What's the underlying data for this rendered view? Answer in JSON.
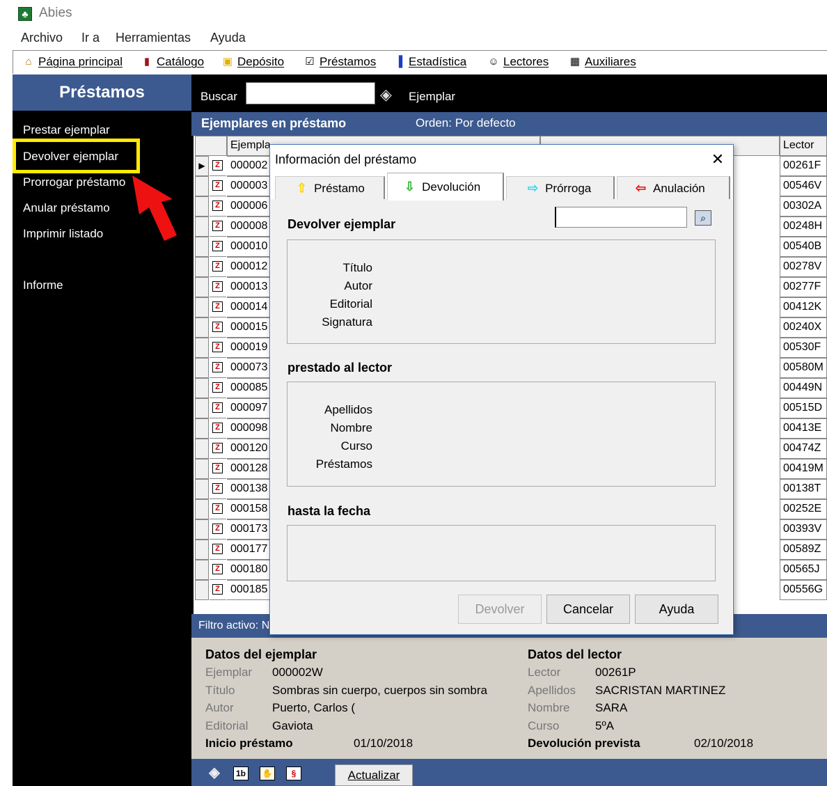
{
  "window": {
    "title": "Abies"
  },
  "menu": [
    "Archivo",
    "Ir a",
    "Herramientas",
    "Ayuda"
  ],
  "toolbar": [
    {
      "icon": "home-icon",
      "label": "Página principal"
    },
    {
      "icon": "books-icon",
      "label": "Catálogo"
    },
    {
      "icon": "jar-icon",
      "label": "Depósito"
    },
    {
      "icon": "checkbox-icon",
      "label": "Préstamos"
    },
    {
      "icon": "bar-chart-icon",
      "label": "Estadística"
    },
    {
      "icon": "readers-icon",
      "label": "Lectores"
    },
    {
      "icon": "table-icon",
      "label": "Auxiliares"
    }
  ],
  "sidebar": {
    "title": "Préstamos",
    "items": [
      "Prestar ejemplar",
      "Devolver ejemplar",
      "Prorrogar préstamo",
      "Anular préstamo",
      "Imprimir listado",
      "Informe"
    ],
    "highlight_color": "#ffeb00"
  },
  "search": {
    "label": "Buscar",
    "value": "",
    "mode": "Ejemplar"
  },
  "list": {
    "title": "Ejemplares en préstamo",
    "order": "Orden: Por defecto",
    "columns": {
      "ejemplar": "Ejempla",
      "lector": "Lector"
    },
    "rows": [
      {
        "code": "000002",
        "lector": "00261F"
      },
      {
        "code": "000003",
        "lector": "00546V"
      },
      {
        "code": "000006",
        "lector": "00302A"
      },
      {
        "code": "000008",
        "lector": "00248H"
      },
      {
        "code": "000010",
        "lector": "00540B"
      },
      {
        "code": "000012",
        "lector": "00278V"
      },
      {
        "code": "000013",
        "lector": "00277F"
      },
      {
        "code": "000014",
        "lector": "00412K"
      },
      {
        "code": "000015",
        "lector": "00240X"
      },
      {
        "code": "000019",
        "lector": "00530F"
      },
      {
        "code": "000073",
        "lector": "00580M"
      },
      {
        "code": "000085",
        "lector": "00449N"
      },
      {
        "code": "000097",
        "lector": "00515D"
      },
      {
        "code": "000098",
        "lector": "00413E"
      },
      {
        "code": "000120",
        "lector": "00474Z"
      },
      {
        "code": "000128",
        "lector": "00419M"
      },
      {
        "code": "000138",
        "lector": "00138T"
      },
      {
        "code": "000158",
        "lector": "00252E"
      },
      {
        "code": "000173",
        "lector": "00393V"
      },
      {
        "code": "000177",
        "lector": "00589Z"
      },
      {
        "code": "000180",
        "lector": "00565J"
      },
      {
        "code": "000185",
        "lector": "00556G"
      }
    ]
  },
  "filter": {
    "label": "Filtro activo: N"
  },
  "details": {
    "ejemplar_title": "Datos del ejemplar",
    "lector_title": "Datos del lector",
    "ejemplar_fields": [
      {
        "key": "Ejemplar",
        "value": "000002W"
      },
      {
        "key": "Título",
        "value": "Sombras sin cuerpo, cuerpos sin sombra"
      },
      {
        "key": "Autor",
        "value": "Puerto, Carlos ("
      },
      {
        "key": "Editorial",
        "value": "Gaviota"
      }
    ],
    "lector_fields": [
      {
        "key": "Lector",
        "value": "00261P"
      },
      {
        "key": "Apellidos",
        "value": "SACRISTAN MARTINEZ"
      },
      {
        "key": "Nombre",
        "value": "SARA"
      },
      {
        "key": "Curso",
        "value": "5ºA"
      }
    ],
    "inicio_label": "Inicio préstamo",
    "inicio_value": "01/10/2018",
    "devolucion_label": "Devolución prevista",
    "devolucion_value": "02/10/2018"
  },
  "bottombar": {
    "refresh": "Actualizar"
  },
  "dialog": {
    "title": "Información del préstamo",
    "tabs": [
      {
        "label": "Préstamo",
        "icon": "up-arrow-icon",
        "color": "#ffd400"
      },
      {
        "label": "Devolución",
        "icon": "down-arrow-icon",
        "color": "#2fb52f"
      },
      {
        "label": "Prórroga",
        "icon": "right-arrow-icon",
        "color": "#33d6f0"
      },
      {
        "label": "Anulación",
        "icon": "left-arrow-icon",
        "color": "#e01010"
      }
    ],
    "active_tab": "Devolución",
    "section1": "Devolver ejemplar",
    "section1_fields": [
      "Título",
      "Autor",
      "Editorial",
      "Signatura"
    ],
    "section2": "prestado al lector",
    "section2_fields": [
      "Apellidos",
      "Nombre",
      "Curso",
      "Préstamos"
    ],
    "section3": "hasta la fecha",
    "input_value": "",
    "buttons": {
      "devolver": "Devolver",
      "cancelar": "Cancelar",
      "ayuda": "Ayuda"
    }
  }
}
